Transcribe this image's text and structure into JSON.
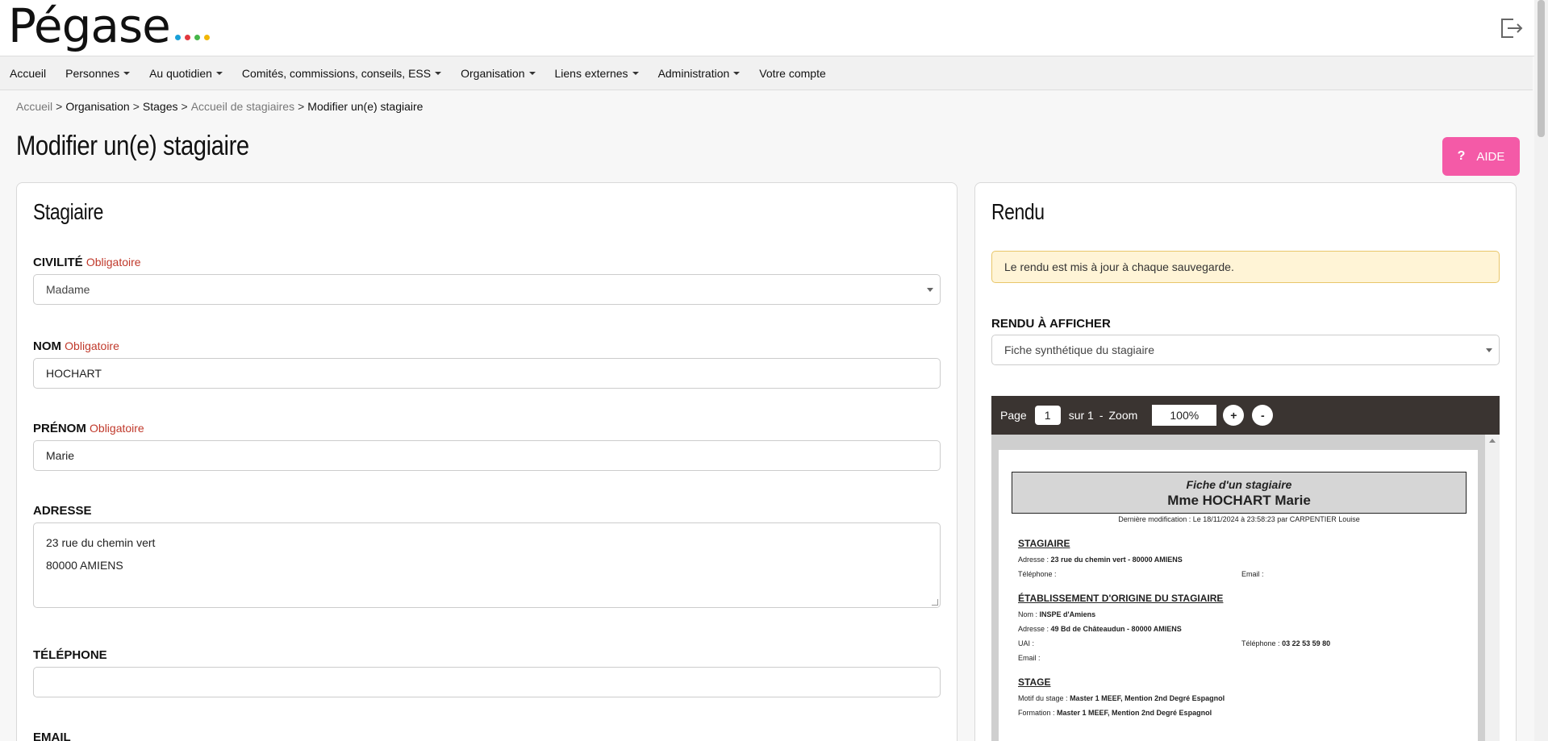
{
  "app": {
    "logo_text": "Pégase",
    "logo_dots": [
      "#1aa0d8",
      "#e2383f",
      "#45b649",
      "#f2b705"
    ]
  },
  "nav": {
    "items": [
      {
        "label": "Accueil",
        "dropdown": false
      },
      {
        "label": "Personnes",
        "dropdown": true
      },
      {
        "label": "Au quotidien",
        "dropdown": true
      },
      {
        "label": "Comités, commissions, conseils, ESS",
        "dropdown": true
      },
      {
        "label": "Organisation",
        "dropdown": true
      },
      {
        "label": "Liens externes",
        "dropdown": true
      },
      {
        "label": "Administration",
        "dropdown": true
      },
      {
        "label": "Votre compte",
        "dropdown": false
      }
    ]
  },
  "breadcrumb": {
    "home": "Accueil",
    "organisation": "Organisation",
    "stages": "Stages",
    "accueil_stagiaires": "Accueil de stagiaires",
    "current": "Modifier un(e) stagiaire",
    "separator": ">"
  },
  "page": {
    "title": "Modifier un(e) stagiaire",
    "aide_label": "AIDE",
    "aide_icon": "?"
  },
  "form": {
    "title": "Stagiaire",
    "required_label": "Obligatoire",
    "civilite": {
      "label": "CIVILITÉ",
      "value": "Madame"
    },
    "nom": {
      "label": "NOM",
      "value": "HOCHART"
    },
    "prenom": {
      "label": "PRÉNOM",
      "value": "Marie"
    },
    "adresse": {
      "label": "ADRESSE",
      "line1": "23 rue du chemin vert",
      "line2": "80000 AMIENS"
    },
    "telephone": {
      "label": "TÉLÉPHONE",
      "value": ""
    },
    "email": {
      "label": "EMAIL"
    }
  },
  "rendu": {
    "title": "Rendu",
    "alert": "Le rendu est mis à jour à chaque sauvegarde.",
    "select_label": "RENDU À AFFICHER",
    "select_value": "Fiche synthétique du stagiaire",
    "viewer": {
      "page_label": "Page",
      "page_value": "1",
      "of_label": "sur 1",
      "dash": "-",
      "zoom_label": "Zoom",
      "zoom_value": "100%",
      "zoom_in": "+",
      "zoom_out": "-"
    },
    "doc": {
      "heading": "Fiche d'un stagiaire",
      "name": "Mme HOCHART Marie",
      "modified": "Dernière modification : Le 18/11/2024 à 23:58:23 par CARPENTIER Louise",
      "section1": "STAGIAIRE",
      "s1_adresse_label": "Adresse :",
      "s1_adresse": "23 rue du chemin vert - 80000 AMIENS",
      "s1_tel_label": "Téléphone :",
      "s1_email_label": "Email :",
      "section2": "ÉTABLISSEMENT D'ORIGINE DU STAGIAIRE",
      "s2_nom_label": "Nom :",
      "s2_nom": "INSPE d'Amiens",
      "s2_adresse_label": "Adresse :",
      "s2_adresse": "49 Bd de Châteaudun - 80000 AMIENS",
      "s2_uai_label": "UAI :",
      "s2_tel_label": "Téléphone :",
      "s2_tel": "03 22 53 59 80",
      "s2_email_label": "Email :",
      "section3": "STAGE",
      "s3_motif_label": "Motif du stage :",
      "s3_motif": "Master 1 MEEF, Mention 2nd Degré Espagnol",
      "s3_formation_label": "Formation :",
      "s3_formation": "Master 1 MEEF, Mention 2nd Degré Espagnol"
    }
  }
}
